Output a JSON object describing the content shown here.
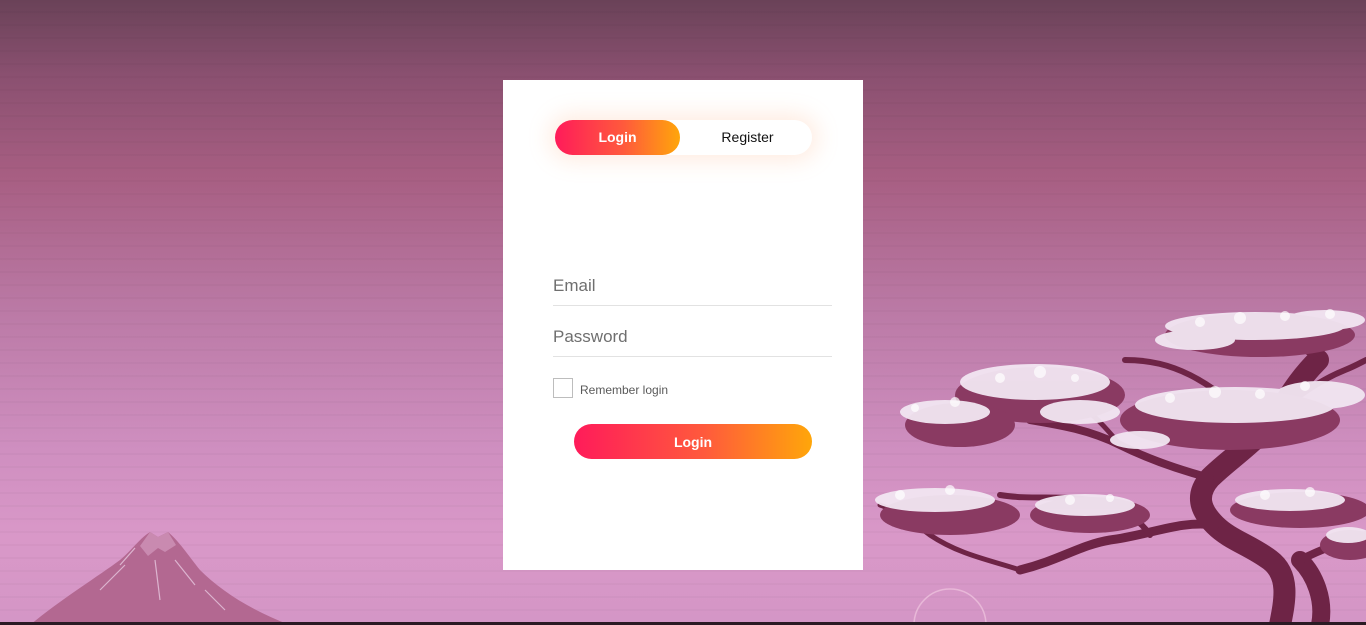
{
  "background": {
    "sky_top_color": "#6a4258",
    "sky_bottom_color": "#d998c8",
    "mountain_color": "#b56a93",
    "tree_trunk_color": "#6e2446",
    "blossom_color": "#f2e6f2"
  },
  "auth_toggle": {
    "login_label": "Login",
    "register_label": "Register",
    "active": "login"
  },
  "form": {
    "email_placeholder": "Email",
    "email_value": "",
    "password_placeholder": "Password",
    "password_value": "",
    "remember_label": "Remember login",
    "remember_checked": false,
    "submit_label": "Login"
  },
  "accent_gradient": [
    "#ff1b5a",
    "#ffa60a"
  ]
}
